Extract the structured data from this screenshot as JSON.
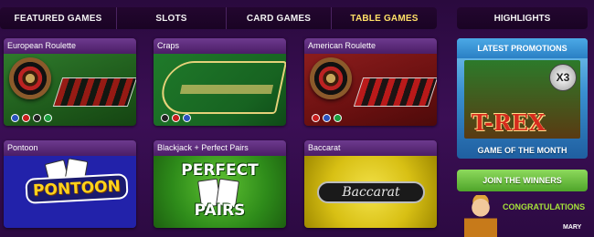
{
  "nav": {
    "items": [
      {
        "label": "FEATURED GAMES",
        "active": false
      },
      {
        "label": "SLOTS",
        "active": false
      },
      {
        "label": "CARD GAMES",
        "active": false
      },
      {
        "label": "TABLE GAMES",
        "active": true
      }
    ],
    "highlights_label": "HIGHLIGHTS"
  },
  "games": [
    {
      "title": "European Roulette"
    },
    {
      "title": "Craps"
    },
    {
      "title": "American Roulette"
    },
    {
      "title": "Pontoon",
      "logo": "PONTOON"
    },
    {
      "title": "Blackjack + Perfect Pairs",
      "logo_line1": "PERFECT",
      "logo_line2": "PAIRS"
    },
    {
      "title": "Baccarat",
      "logo": "Baccarat"
    }
  ],
  "sidebar": {
    "promo_title": "LATEST PROMOTIONS",
    "promo_game": "T-REX",
    "promo_badge": "X3",
    "promo_subtitle": "GAME OF THE MONTH",
    "join_label": "JOIN THE WINNERS",
    "congrats": "CONGRATULATIONS",
    "winner_name": "MARY"
  },
  "colors": {
    "background": "#3b0f55",
    "active_tab": "#ffe066",
    "congrats": "#a6e33a",
    "join_button": "#4fa52a"
  }
}
